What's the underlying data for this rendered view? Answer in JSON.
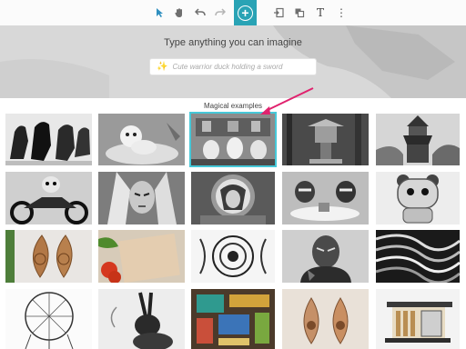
{
  "toolbar": {
    "tools": [
      {
        "name": "select-tool",
        "icon": "cursor-icon",
        "glyph": "➤"
      },
      {
        "name": "hand-tool",
        "icon": "hand-icon",
        "glyph": "✋"
      },
      {
        "name": "undo-button",
        "icon": "undo-icon",
        "glyph": "↶"
      },
      {
        "name": "redo-button",
        "icon": "redo-icon",
        "glyph": "↷"
      },
      {
        "name": "add-button",
        "icon": "plus-circle-icon",
        "glyph": "+"
      },
      {
        "name": "import-button",
        "icon": "import-icon",
        "glyph": "⇥"
      },
      {
        "name": "layers-button",
        "icon": "layers-icon",
        "glyph": "❐"
      },
      {
        "name": "text-tool",
        "icon": "text-icon",
        "glyph": "T"
      },
      {
        "name": "more-button",
        "icon": "more-vertical-icon",
        "glyph": "⋮"
      }
    ],
    "accent": "#29a3b5"
  },
  "hero": {
    "title": "Type anything you can imagine",
    "prompt_placeholder": "Cute warrior duck holding a sword",
    "prompt_icon": "sparkles-icon"
  },
  "examples": {
    "label": "Magical examples",
    "selected_index": 2,
    "highlight_color": "#46c8d8",
    "annotation_color": "#e0226e",
    "items": [
      {
        "name": "horses"
      },
      {
        "name": "dog-in-teacup"
      },
      {
        "name": "ducks-in-kitchen"
      },
      {
        "name": "japanese-lantern-forest"
      },
      {
        "name": "ornate-temple-tower"
      },
      {
        "name": "alien-motorcycle"
      },
      {
        "name": "elf-warrior-woman"
      },
      {
        "name": "astronaut-woman"
      },
      {
        "name": "raccoons-tea-party"
      },
      {
        "name": "robot-bear"
      },
      {
        "name": "carved-wood-earrings"
      },
      {
        "name": "vegetables-on-board"
      },
      {
        "name": "mandala-octopus"
      },
      {
        "name": "orc-warrior"
      },
      {
        "name": "abstract-waves"
      },
      {
        "name": "dreamcatcher-sketch"
      },
      {
        "name": "rabbit-ink-drawing"
      },
      {
        "name": "colorful-circuit-board"
      },
      {
        "name": "wooden-earrings"
      },
      {
        "name": "modern-house-model"
      }
    ]
  }
}
